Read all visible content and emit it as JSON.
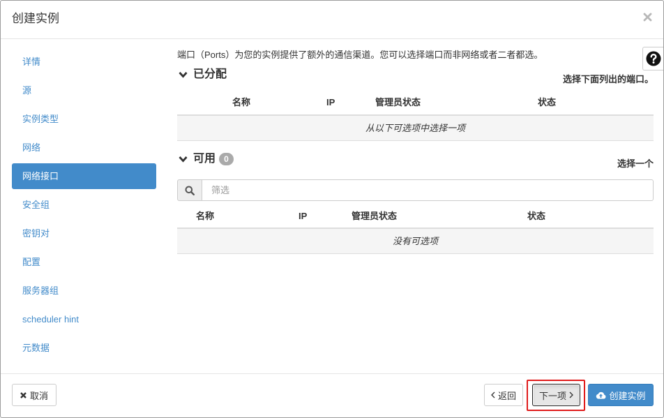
{
  "window": {
    "title": "创建实例"
  },
  "sidebar": {
    "items": [
      {
        "label": "详情",
        "active": false
      },
      {
        "label": "源",
        "active": false
      },
      {
        "label": "实例类型",
        "active": false
      },
      {
        "label": "网络",
        "active": false
      },
      {
        "label": "网络接口",
        "active": true
      },
      {
        "label": "安全组",
        "active": false
      },
      {
        "label": "密钥对",
        "active": false
      },
      {
        "label": "配置",
        "active": false
      },
      {
        "label": "服务器组",
        "active": false
      },
      {
        "label": "scheduler hint",
        "active": false
      },
      {
        "label": "元数据",
        "active": false
      }
    ]
  },
  "main": {
    "help_text": "端口（Ports）为您的实例提供了额外的通信渠道。您可以选择端口而非网络或者二者都选。",
    "allocated": {
      "heading": "已分配",
      "hint": "选择下面列出的端口。",
      "columns": [
        "名称",
        "IP",
        "管理员状态",
        "状态"
      ],
      "empty_message": "从以下可选项中选择一项"
    },
    "available": {
      "heading": "可用",
      "count": "0",
      "hint": "选择一个",
      "filter_placeholder": "筛选",
      "filter_value": "",
      "columns": [
        "名称",
        "IP",
        "管理员状态",
        "状态"
      ],
      "empty_message": "没有可选项"
    }
  },
  "footer": {
    "cancel_label": "取消",
    "back_label": "返回",
    "next_label": "下一项",
    "create_label": "创建实例"
  },
  "icons": {
    "close": "close-icon",
    "help": "question-circle-icon",
    "section_toggle": "chevron-down-icon",
    "filter": "search-icon",
    "cancel": "times-icon",
    "back": "chevron-left-icon",
    "next": "chevron-right-icon",
    "create": "cloud-upload-icon"
  },
  "colors": {
    "accent": "#428bca",
    "link": "#428bca",
    "badge": "#aaaaaa",
    "highlight": "#e01b1b"
  }
}
